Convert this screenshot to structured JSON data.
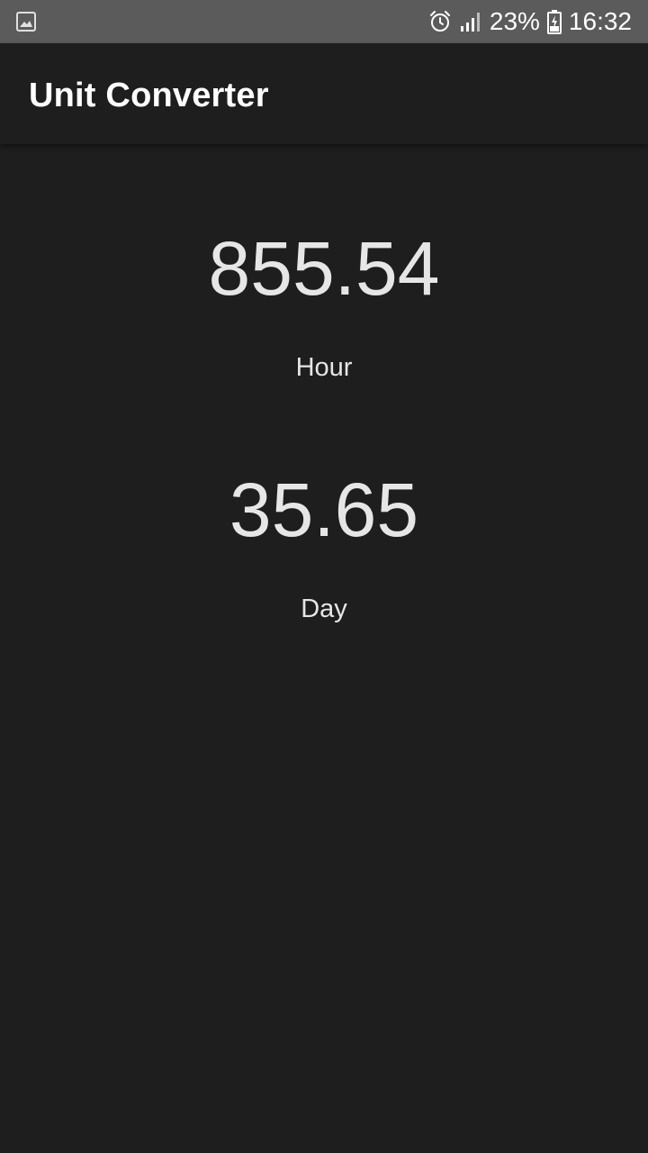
{
  "status_bar": {
    "left_icon": "image-notification-icon",
    "alarm_icon": "alarm-icon",
    "signal_icon": "cell-signal-icon",
    "battery_percent": "23%",
    "battery_icon": "battery-charging-icon",
    "time": "16:32"
  },
  "app_bar": {
    "title": "Unit Converter"
  },
  "results": [
    {
      "value": "855.54",
      "unit": "Hour"
    },
    {
      "value": "35.65",
      "unit": "Day"
    }
  ],
  "colors": {
    "background": "#1e1e1e",
    "status_bar": "#5b5b5b",
    "text_primary": "#e6e6e6",
    "title_text": "#ffffff"
  }
}
